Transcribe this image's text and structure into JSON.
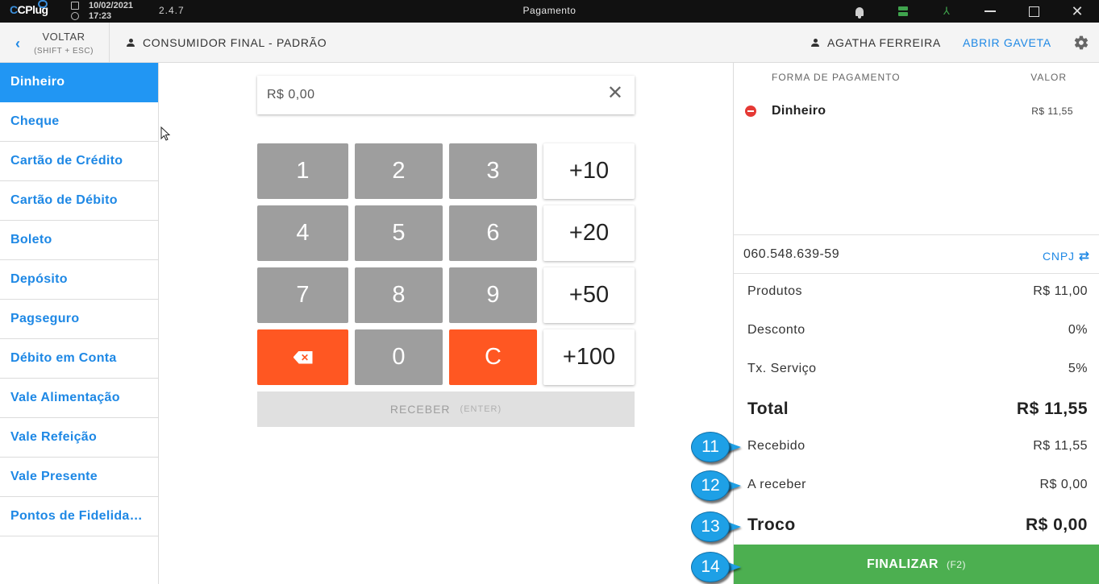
{
  "titlebar": {
    "logo": "CPlug",
    "date": "10/02/2021",
    "time": "17:23",
    "version": "2.4.7",
    "title": "Pagamento",
    "icons": [
      "bell-icon",
      "server-icon",
      "network-icon",
      "minimize-icon",
      "maximize-icon",
      "close-icon"
    ]
  },
  "header": {
    "back_label": "VOLTAR",
    "back_hint": "(SHIFT + ESC)",
    "customer": "CONSUMIDOR FINAL - PADRÃO",
    "operator": "AGATHA FERREIRA",
    "open_drawer": "ABRIR GAVETA"
  },
  "sidebar": {
    "items": [
      {
        "label": "Dinheiro",
        "active": true
      },
      {
        "label": "Cheque"
      },
      {
        "label": "Cartão de Crédito"
      },
      {
        "label": "Cartão de Débito"
      },
      {
        "label": "Boleto"
      },
      {
        "label": "Depósito"
      },
      {
        "label": "Pagseguro"
      },
      {
        "label": "Débito em Conta"
      },
      {
        "label": "Vale Alimentação"
      },
      {
        "label": "Vale Refeição"
      },
      {
        "label": "Vale Presente"
      },
      {
        "label": "Pontos de Fidelida…"
      }
    ]
  },
  "amount": {
    "value": "R$  0,00"
  },
  "keypad": {
    "k1": "1",
    "k2": "2",
    "k3": "3",
    "k4": "4",
    "k5": "5",
    "k6": "6",
    "k7": "7",
    "k8": "8",
    "k9": "9",
    "k0": "0",
    "clear": "C",
    "add10": "+10",
    "add20": "+20",
    "add50": "+50",
    "add100": "+100"
  },
  "receive": {
    "label": "RECEBER",
    "hint": "(ENTER)"
  },
  "payments": {
    "col_method": "FORMA DE PAGAMENTO",
    "col_value": "VALOR",
    "rows": [
      {
        "method": "Dinheiro",
        "value": "R$ 11,55"
      }
    ]
  },
  "document": {
    "value": "060.548.639-59",
    "type": "CNPJ"
  },
  "summary": {
    "products_label": "Produtos",
    "products_value": "R$ 11,00",
    "discount_label": "Desconto",
    "discount_value": "0%",
    "service_label": "Tx. Serviço",
    "service_value": "5%",
    "total_label": "Total",
    "total_value": "R$ 11,55",
    "received_label": "Recebido",
    "received_value": "R$ 11,55",
    "to_receive_label": "A receber",
    "to_receive_value": "R$ 0,00",
    "change_label": "Troco",
    "change_value": "R$ 0,00"
  },
  "finalize": {
    "label": "FINALIZAR",
    "hint": "(F2)"
  },
  "callouts": [
    "11",
    "12",
    "13",
    "14"
  ],
  "colors": {
    "accent": "#2196f3",
    "link": "#1e88e5",
    "danger": "#ff5722",
    "key_gray": "#9e9e9e",
    "success": "#4caf50",
    "callout": "#1ea0e6"
  }
}
